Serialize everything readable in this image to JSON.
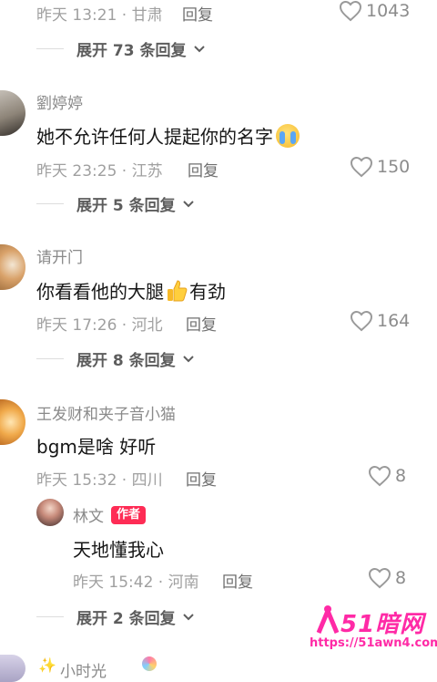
{
  "reply_label": "回复",
  "comments": [
    {
      "time_location": "昨天 13:21 · 甘肃",
      "likes": "1043",
      "expand_text": "展开 73 条回复"
    },
    {
      "username": "劉婷婷",
      "content": "她不允许任何人提起你的名字",
      "emoji": "crying-face",
      "time_location": "昨天 23:25 · 江苏",
      "likes": "150",
      "expand_text": "展开 5 条回复"
    },
    {
      "username": "请开门",
      "content_before": "你看看他的大腿",
      "emoji": "thumbs-up",
      "content_after": "有劲",
      "time_location": "昨天 17:26 · 河北",
      "likes": "164",
      "expand_text": "展开 8 条回复"
    },
    {
      "username": "王发财和夹子音小猫",
      "content": "bgm是啥 好听",
      "time_location": "昨天 15:32 · 四川",
      "likes": "8",
      "reply": {
        "username": "林文",
        "badge": "作者",
        "content": "天地懂我心",
        "time_location": "昨天 15:42 · 河南",
        "likes": "8"
      },
      "expand_text": "展开 2 条回复"
    },
    {
      "username": "小时光"
    }
  ],
  "watermark": {
    "logo_text": "51暗网",
    "url": "https://51awn4.com"
  },
  "colors": {
    "accent_badge": "#fe2c55",
    "watermark_pink": "#ff2aa6",
    "meta_gray": "#a0a0a0"
  }
}
